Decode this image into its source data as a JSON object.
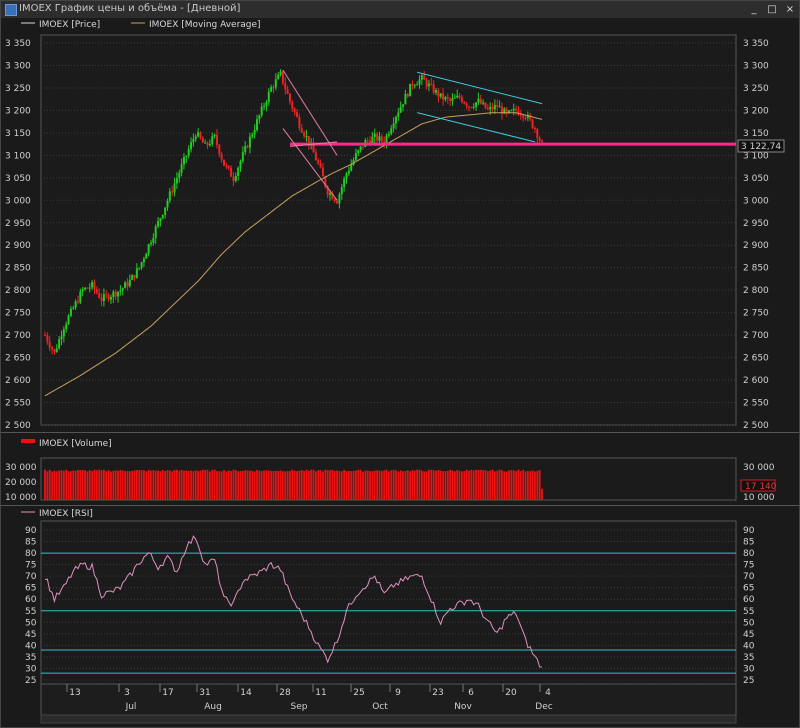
{
  "window": {
    "title": "IMOEX График цены и объёма - [Дневной]",
    "buttons": {
      "minimize": "_",
      "maximize": "□",
      "close": "×"
    }
  },
  "colors": {
    "background": "#1a1a1a",
    "up_candle": "#22cc22",
    "down_candle": "#ee2222",
    "moving_average": "#c8a060",
    "trend_line": "#e080a0",
    "horizontal_level": "#ff2a8a",
    "channel": "#40c8e0",
    "volume": "#ee1111",
    "rsi": "#e090c0",
    "rsi_levels": "#30c0c8",
    "grid": "#3a3a3a"
  },
  "chart_data": [
    {
      "type": "candlestick",
      "legend": [
        {
          "name": "IMOEX [Price]",
          "color": "#d8d8d8"
        },
        {
          "name": "IMOEX [Moving Average]",
          "color": "#c8a060"
        }
      ],
      "ylim": [
        2500,
        3350
      ],
      "yticks": [
        "3 350",
        "3 300",
        "3 250",
        "3 200",
        "3 150",
        "3 100",
        "3 050",
        "3 000",
        "2 950",
        "2 900",
        "2 850",
        "2 800",
        "2 750",
        "2 700",
        "2 650",
        "2 600",
        "2 550",
        "2 500"
      ],
      "last_value_label": "3 122,74",
      "last_value": 3122.74,
      "close_path": [
        [
          0,
          2700
        ],
        [
          4,
          2660
        ],
        [
          8,
          2720
        ],
        [
          12,
          2760
        ],
        [
          16,
          2800
        ],
        [
          20,
          2810
        ],
        [
          24,
          2780
        ],
        [
          28,
          2790
        ],
        [
          32,
          2800
        ],
        [
          36,
          2820
        ],
        [
          40,
          2850
        ],
        [
          44,
          2900
        ],
        [
          48,
          2950
        ],
        [
          52,
          3000
        ],
        [
          56,
          3050
        ],
        [
          60,
          3100
        ],
        [
          64,
          3150
        ],
        [
          68,
          3120
        ],
        [
          72,
          3140
        ],
        [
          76,
          3080
        ],
        [
          80,
          3050
        ],
        [
          84,
          3100
        ],
        [
          88,
          3150
        ],
        [
          92,
          3200
        ],
        [
          96,
          3250
        ],
        [
          100,
          3280
        ],
        [
          104,
          3220
        ],
        [
          108,
          3170
        ],
        [
          112,
          3130
        ],
        [
          116,
          3080
        ],
        [
          120,
          3020
        ],
        [
          124,
          3000
        ],
        [
          128,
          3060
        ],
        [
          132,
          3100
        ],
        [
          136,
          3130
        ],
        [
          140,
          3140
        ],
        [
          144,
          3130
        ],
        [
          148,
          3180
        ],
        [
          152,
          3220
        ],
        [
          156,
          3260
        ],
        [
          160,
          3270
        ],
        [
          164,
          3250
        ],
        [
          168,
          3230
        ],
        [
          172,
          3220
        ],
        [
          176,
          3230
        ],
        [
          180,
          3210
        ],
        [
          184,
          3220
        ],
        [
          188,
          3200
        ],
        [
          192,
          3210
        ],
        [
          196,
          3190
        ],
        [
          200,
          3200
        ],
        [
          204,
          3190
        ],
        [
          208,
          3160
        ],
        [
          211,
          3122.74
        ]
      ],
      "ma_path": [
        [
          0,
          2565
        ],
        [
          15,
          2610
        ],
        [
          30,
          2660
        ],
        [
          45,
          2720
        ],
        [
          55,
          2770
        ],
        [
          65,
          2820
        ],
        [
          75,
          2880
        ],
        [
          85,
          2930
        ],
        [
          95,
          2970
        ],
        [
          105,
          3010
        ],
        [
          115,
          3040
        ],
        [
          122,
          3060
        ],
        [
          130,
          3080
        ],
        [
          140,
          3110
        ],
        [
          150,
          3140
        ],
        [
          160,
          3170
        ],
        [
          170,
          3185
        ],
        [
          180,
          3190
        ],
        [
          190,
          3195
        ],
        [
          200,
          3195
        ],
        [
          211,
          3180
        ]
      ],
      "horizontal_level": 3125
    },
    {
      "type": "bar",
      "legend": [
        {
          "name": "IMOEX [Volume]",
          "color": "#ee1111"
        }
      ],
      "ylim": [
        10000,
        34000
      ],
      "yticks_left": [
        "30 000",
        "20 000",
        "10 000"
      ],
      "yticks_right": [
        "30 000",
        "20 000",
        "10 000"
      ],
      "last_value_label": "17 140",
      "last_value": 17140
    },
    {
      "type": "line",
      "legend": [
        {
          "name": "IMOEX [RSI]",
          "color": "#e090c0"
        }
      ],
      "ylim": [
        25,
        90
      ],
      "yticks": [
        "90",
        "85",
        "80",
        "75",
        "70",
        "65",
        "60",
        "55",
        "50",
        "45",
        "40",
        "35",
        "30",
        "25"
      ],
      "levels": [
        80,
        55,
        38,
        28
      ],
      "rsi_path": [
        [
          0,
          70
        ],
        [
          4,
          60
        ],
        [
          8,
          65
        ],
        [
          12,
          72
        ],
        [
          16,
          75
        ],
        [
          20,
          74
        ],
        [
          24,
          62
        ],
        [
          28,
          63
        ],
        [
          32,
          65
        ],
        [
          36,
          70
        ],
        [
          40,
          76
        ],
        [
          44,
          80
        ],
        [
          48,
          74
        ],
        [
          52,
          78
        ],
        [
          56,
          72
        ],
        [
          60,
          83
        ],
        [
          64,
          87
        ],
        [
          68,
          75
        ],
        [
          72,
          77
        ],
        [
          76,
          60
        ],
        [
          80,
          58
        ],
        [
          84,
          68
        ],
        [
          88,
          70
        ],
        [
          92,
          72
        ],
        [
          96,
          75
        ],
        [
          100,
          73
        ],
        [
          104,
          62
        ],
        [
          108,
          55
        ],
        [
          112,
          48
        ],
        [
          116,
          40
        ],
        [
          120,
          34
        ],
        [
          124,
          42
        ],
        [
          128,
          55
        ],
        [
          132,
          62
        ],
        [
          136,
          66
        ],
        [
          140,
          70
        ],
        [
          144,
          62
        ],
        [
          148,
          66
        ],
        [
          152,
          68
        ],
        [
          156,
          70
        ],
        [
          160,
          70
        ],
        [
          164,
          60
        ],
        [
          168,
          50
        ],
        [
          172,
          56
        ],
        [
          176,
          58
        ],
        [
          180,
          60
        ],
        [
          184,
          57
        ],
        [
          188,
          50
        ],
        [
          192,
          45
        ],
        [
          196,
          52
        ],
        [
          200,
          54
        ],
        [
          204,
          42
        ],
        [
          208,
          35
        ],
        [
          211,
          30
        ]
      ]
    }
  ],
  "x_axis": {
    "day_ticks": [
      "13",
      "3",
      "17",
      "31",
      "14",
      "28",
      "11",
      "25",
      "9",
      "23",
      "6",
      "20",
      "4"
    ],
    "month_labels": [
      "Jul",
      "Aug",
      "Sep",
      "Oct",
      "Nov",
      "Dec"
    ]
  }
}
